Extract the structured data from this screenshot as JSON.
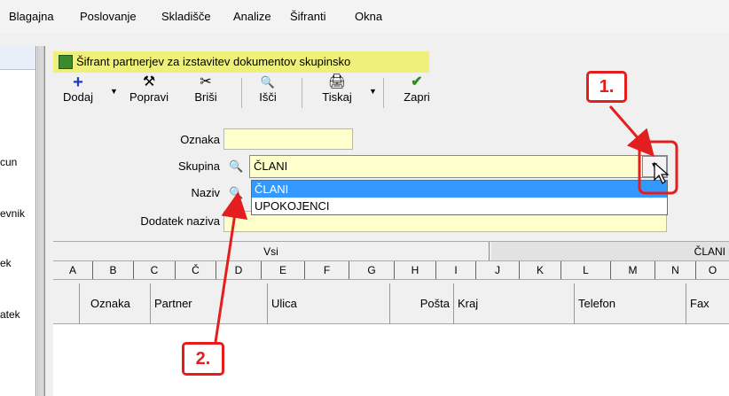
{
  "menu": {
    "items": [
      {
        "label": "Blagajna"
      },
      {
        "label": "Poslovanje"
      },
      {
        "label": "Skladišče"
      },
      {
        "label": "Analize"
      },
      {
        "label": "Šifranti"
      },
      {
        "label": "Okna"
      }
    ]
  },
  "sidebar": {
    "labels": [
      "cun",
      "evnik",
      "ek",
      "atek"
    ]
  },
  "window": {
    "title": "Šifrant partnerjev za izstavitev dokumentov skupinsko"
  },
  "toolbar": {
    "dodaj": "Dodaj",
    "popravi": "Popravi",
    "brisi": "Briši",
    "isci": "Išči",
    "tiskaj": "Tiskaj",
    "zapri": "Zapri"
  },
  "form": {
    "oznaka_label": "Oznaka",
    "oznaka_value": "",
    "skupina_label": "Skupina",
    "skupina_value": "ČLANI",
    "naziv_label": "Naziv",
    "dodatek_label": "Dodatek naziva",
    "dodatek_value": ""
  },
  "dropdown": {
    "options": [
      {
        "label": "ČLANI",
        "selected": true
      },
      {
        "label": "UPOKOJENCI",
        "selected": false
      }
    ]
  },
  "tabs": [
    {
      "label": "Vsi"
    },
    {
      "label": "ČLANI"
    }
  ],
  "letters": [
    "A",
    "B",
    "C",
    "Č",
    "D",
    "E",
    "F",
    "G",
    "H",
    "I",
    "J",
    "K",
    "L",
    "M",
    "N",
    "O"
  ],
  "columns": [
    "Oznaka",
    "Partner",
    "Ulica",
    "Pošta",
    "Kraj",
    "Telefon",
    "Fax"
  ],
  "callouts": {
    "one": "1.",
    "two": "2."
  },
  "colors": {
    "title_highlight": "#eef07a",
    "selection": "#3399ff",
    "callout": "#e41e1e",
    "input_bg": "#ffffcc"
  }
}
